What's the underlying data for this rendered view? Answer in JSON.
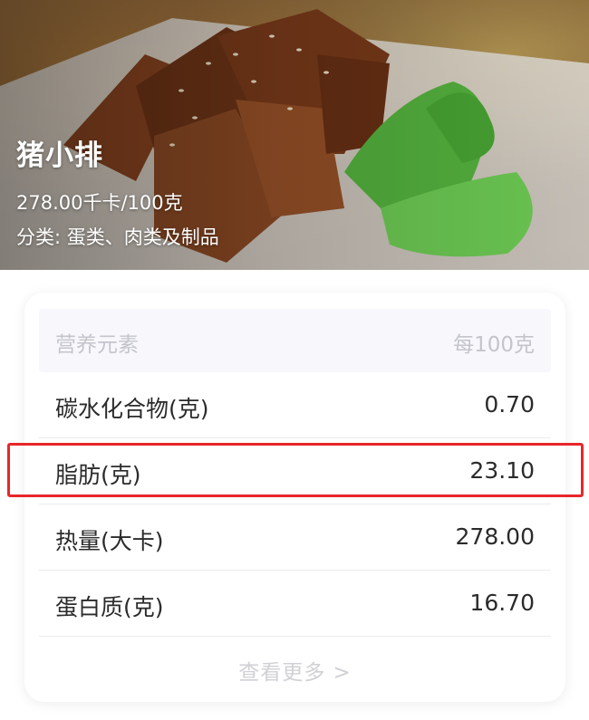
{
  "food": {
    "name": "猪小排",
    "energy": "278.00千卡/100克",
    "category": "分类: 蛋类、肉类及制品"
  },
  "nutrition": {
    "header_left": "营养元素",
    "header_right": "每100克",
    "rows": [
      {
        "label": "碳水化合物(克)",
        "value": "0.70"
      },
      {
        "label": "脂肪(克)",
        "value": "23.10"
      },
      {
        "label": "热量(大卡)",
        "value": "278.00"
      },
      {
        "label": "蛋白质(克)",
        "value": "16.70"
      }
    ],
    "more_label": "查看更多 >"
  },
  "highlighted_row_index": 1,
  "colors": {
    "highlight": "#e8262a",
    "header_bg": "#f7f7fc",
    "muted_text": "#c4c4cc"
  },
  "icons": {
    "more": "chevron-right-icon"
  }
}
